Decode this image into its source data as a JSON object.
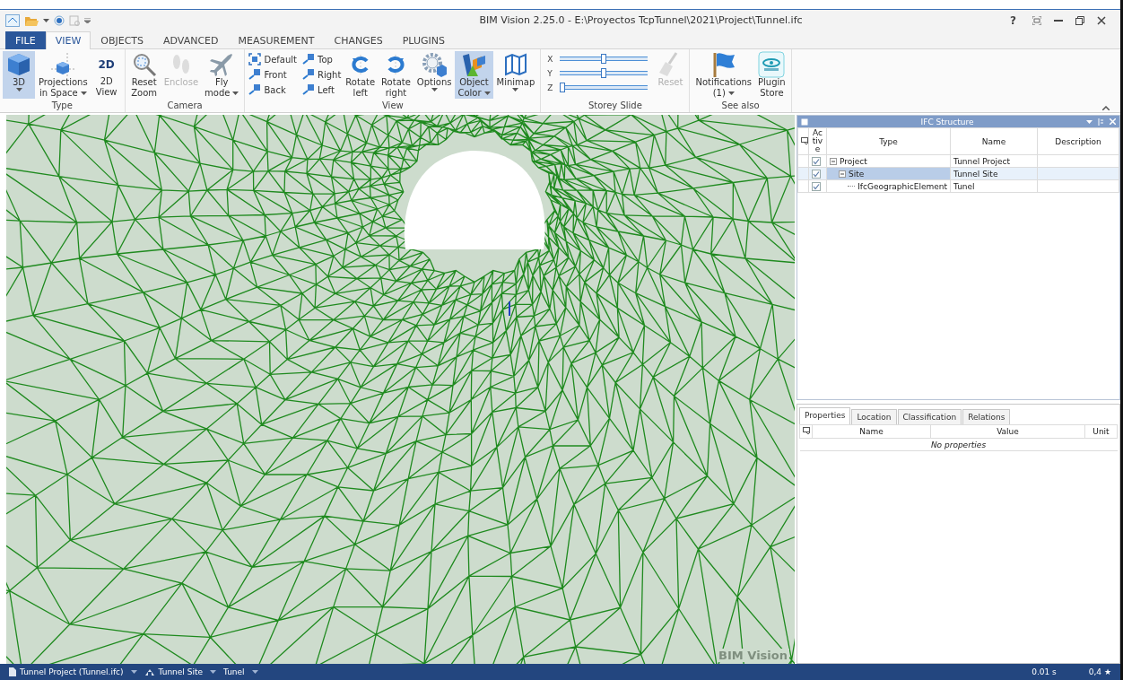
{
  "window": {
    "title": "BIM Vision 2.25.0 - E:\\Proyectos TcpTunnel\\2021\\Project\\Tunnel.ifc",
    "help": "?"
  },
  "ribbon_tabs": [
    {
      "label": "FILE",
      "kind": "file",
      "selected": false
    },
    {
      "label": "VIEW",
      "kind": "tab",
      "selected": true
    },
    {
      "label": "OBJECTS",
      "kind": "tab",
      "selected": false
    },
    {
      "label": "ADVANCED",
      "kind": "tab",
      "selected": false
    },
    {
      "label": "MEASUREMENT",
      "kind": "tab",
      "selected": false
    },
    {
      "label": "CHANGES",
      "kind": "tab",
      "selected": false
    },
    {
      "label": "PLUGINS",
      "kind": "tab",
      "selected": false
    }
  ],
  "ribbon_groups": [
    {
      "label": "Type",
      "items": [
        {
          "kind": "large",
          "lines": [
            "3D"
          ],
          "dropdown": true,
          "selected": true,
          "disabled": false
        },
        {
          "kind": "large",
          "lines": [
            "Projections",
            "in Space"
          ],
          "dropdown": true,
          "selected": false,
          "disabled": false
        },
        {
          "kind": "large",
          "badge": "2D",
          "lines": [
            "2D",
            "View"
          ],
          "dropdown": false,
          "selected": false,
          "disabled": false
        }
      ]
    },
    {
      "label": "Camera",
      "items": [
        {
          "kind": "large",
          "lines": [
            "Reset",
            "Zoom"
          ],
          "dropdown": false,
          "selected": false,
          "disabled": false
        },
        {
          "kind": "large",
          "lines": [
            "Enclose"
          ],
          "dropdown": false,
          "selected": false,
          "disabled": true
        },
        {
          "kind": "large",
          "lines": [
            "Fly",
            "mode"
          ],
          "dropdown": true,
          "selected": false,
          "disabled": false
        }
      ]
    },
    {
      "label": "View",
      "items": [
        {
          "kind": "small_grid",
          "buttons": [
            {
              "label": "Default"
            },
            {
              "label": "Top"
            },
            {
              "label": "Front"
            },
            {
              "label": "Right"
            },
            {
              "label": "Back"
            },
            {
              "label": "Left"
            }
          ]
        },
        {
          "kind": "large",
          "lines": [
            "Rotate",
            "left"
          ],
          "dropdown": false,
          "selected": false,
          "disabled": false
        },
        {
          "kind": "large",
          "lines": [
            "Rotate",
            "right"
          ],
          "dropdown": false,
          "selected": false,
          "disabled": false
        },
        {
          "kind": "large",
          "lines": [
            "Options"
          ],
          "dropdown": true,
          "selected": false,
          "disabled": false
        },
        {
          "kind": "large",
          "lines": [
            "Object",
            "Color"
          ],
          "dropdown": true,
          "selected": true,
          "disabled": false
        },
        {
          "kind": "large",
          "lines": [
            "Minimap"
          ],
          "dropdown": true,
          "selected": false,
          "disabled": false
        }
      ]
    },
    {
      "label": "Storey Slide",
      "items": [
        {
          "kind": "sliders",
          "sliders": [
            {
              "label": "X",
              "level": 0.5
            },
            {
              "label": "Y",
              "level": 0.5
            },
            {
              "label": "Z",
              "level": 0.0
            }
          ]
        },
        {
          "kind": "large",
          "lines": [
            "Reset"
          ],
          "dropdown": false,
          "selected": false,
          "disabled": true
        }
      ]
    },
    {
      "label": "See also",
      "items": [
        {
          "kind": "large",
          "lines": [
            "Notifications",
            "(1)"
          ],
          "dropdown": true,
          "selected": false,
          "disabled": false
        },
        {
          "kind": "large",
          "lines": [
            "Plugin",
            "Store"
          ],
          "dropdown": false,
          "selected": false,
          "disabled": false
        }
      ]
    }
  ],
  "viewport": {
    "mark": "BIM Vision"
  },
  "ifc_structure": {
    "title": "IFC Structure",
    "columns": [
      "Active",
      "Type",
      "Name",
      "Description"
    ],
    "rows": [
      {
        "type": "Project",
        "name": "Tunnel Project",
        "checked": true,
        "selected": false,
        "expanded": true,
        "children": [
          {
            "type": "Site",
            "name": "Tunnel Site",
            "checked": true,
            "selected": true,
            "expanded": true,
            "children": [
              {
                "type": "IfcGeographicElement",
                "name": "Tunel",
                "checked": true,
                "selected": false
              }
            ]
          }
        ]
      }
    ]
  },
  "properties": {
    "tabs": [
      {
        "label": "Properties",
        "selected": true
      },
      {
        "label": "Location",
        "selected": false
      },
      {
        "label": "Classification",
        "selected": false
      },
      {
        "label": "Relations",
        "selected": false
      }
    ],
    "columns": [
      "Name",
      "Value",
      "Unit"
    ],
    "empty_message": "No properties"
  },
  "status_bar": {
    "breadcrumb": [
      {
        "label": "Tunnel Project (Tunnel.ifc)"
      },
      {
        "label": "Tunnel Site"
      },
      {
        "label": "Tunel"
      }
    ],
    "timing": "0.01 s",
    "rating": "0,4 ★"
  }
}
